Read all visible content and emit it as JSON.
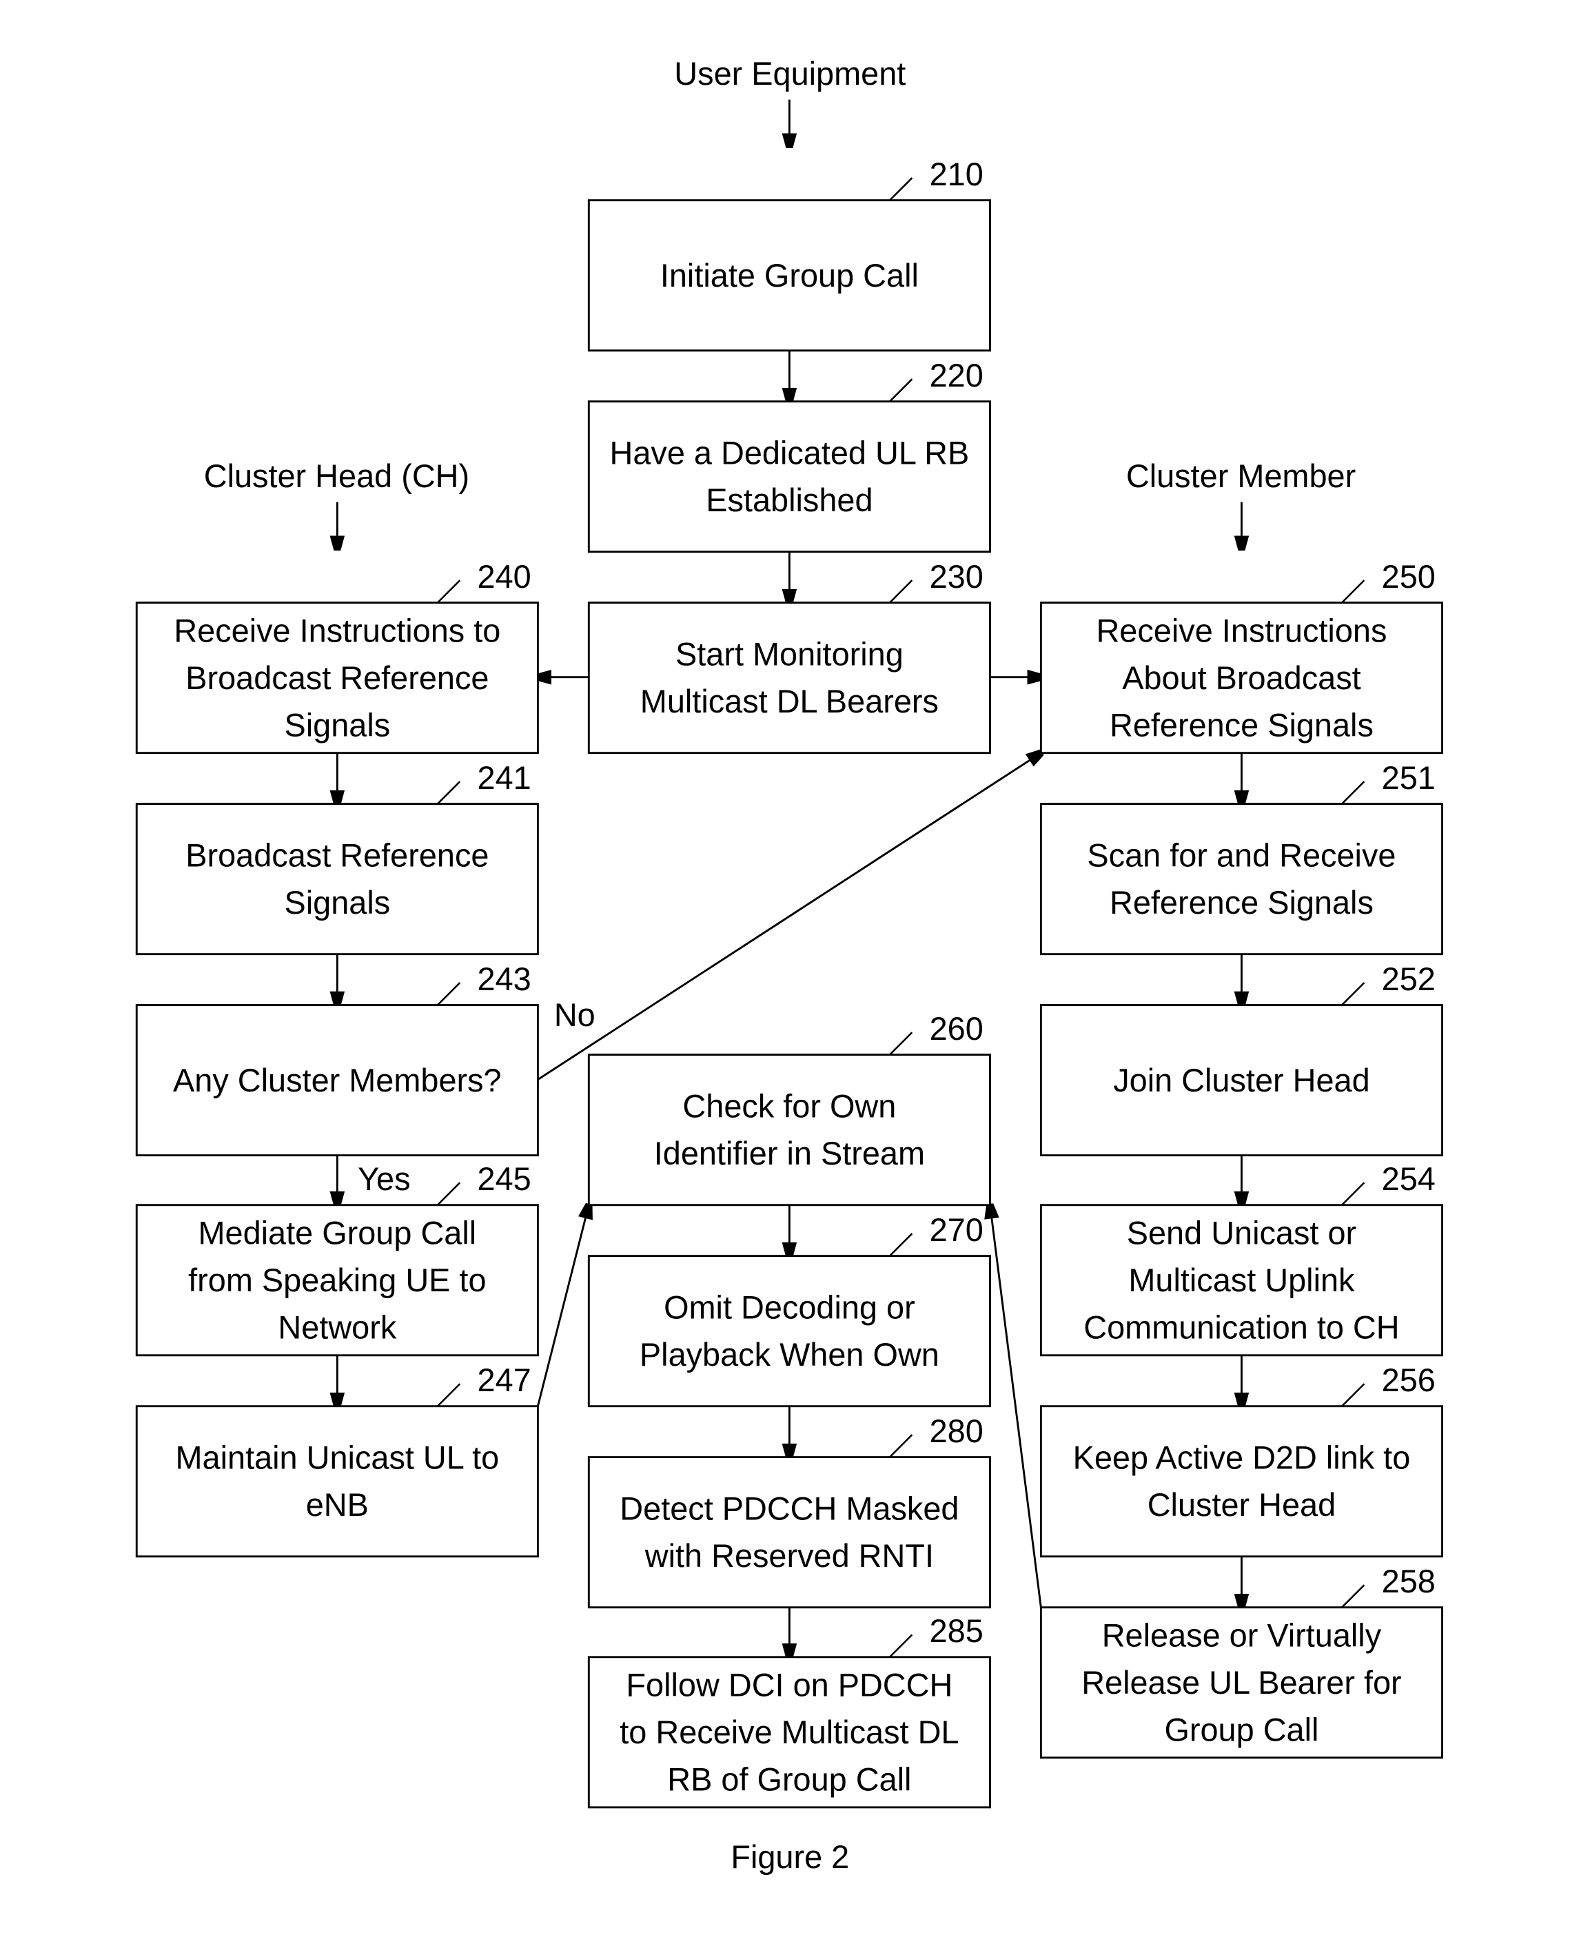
{
  "figure_caption": "Figure 2",
  "column_headers": {
    "user_equipment": "User Equipment",
    "cluster_head": "Cluster Head (CH)",
    "cluster_member": "Cluster Member"
  },
  "edge_labels": {
    "no": "No",
    "yes": "Yes"
  },
  "steps": {
    "s210": {
      "ref": "210",
      "lines": [
        "Initiate Group Call"
      ]
    },
    "s220": {
      "ref": "220",
      "lines": [
        "Have a Dedicated UL RB",
        "Established"
      ]
    },
    "s230": {
      "ref": "230",
      "lines": [
        "Start Monitoring",
        "Multicast DL Bearers"
      ]
    },
    "s240": {
      "ref": "240",
      "lines": [
        "Receive Instructions to",
        "Broadcast Reference",
        "Signals"
      ]
    },
    "s241": {
      "ref": "241",
      "lines": [
        "Broadcast Reference",
        "Signals"
      ]
    },
    "s243": {
      "ref": "243",
      "lines": [
        "Any Cluster Members?"
      ]
    },
    "s245": {
      "ref": "245",
      "lines": [
        "Mediate Group Call",
        "from Speaking UE to",
        "Network"
      ]
    },
    "s247": {
      "ref": "247",
      "lines": [
        "Maintain Unicast UL to",
        "eNB"
      ]
    },
    "s250": {
      "ref": "250",
      "lines": [
        "Receive Instructions",
        "About Broadcast",
        "Reference Signals"
      ]
    },
    "s251": {
      "ref": "251",
      "lines": [
        "Scan for and Receive",
        "Reference Signals"
      ]
    },
    "s252": {
      "ref": "252",
      "lines": [
        "Join Cluster Head"
      ]
    },
    "s254": {
      "ref": "254",
      "lines": [
        "Send Unicast or",
        "Multicast Uplink",
        "Communication to CH"
      ]
    },
    "s256": {
      "ref": "256",
      "lines": [
        "Keep Active D2D link to",
        "Cluster Head"
      ]
    },
    "s258": {
      "ref": "258",
      "lines": [
        "Release or Virtually",
        "Release UL Bearer for",
        "Group Call"
      ]
    },
    "s260": {
      "ref": "260",
      "lines": [
        "Check for Own",
        "Identifier in Stream"
      ]
    },
    "s270": {
      "ref": "270",
      "lines": [
        "Omit Decoding or",
        "Playback When Own"
      ]
    },
    "s280": {
      "ref": "280",
      "lines": [
        "Detect PDCCH Masked",
        "with Reserved RNTI"
      ]
    },
    "s285": {
      "ref": "285",
      "lines": [
        "Follow DCI on PDCCH",
        "to Receive Multicast DL",
        "RB of Group Call"
      ]
    }
  }
}
